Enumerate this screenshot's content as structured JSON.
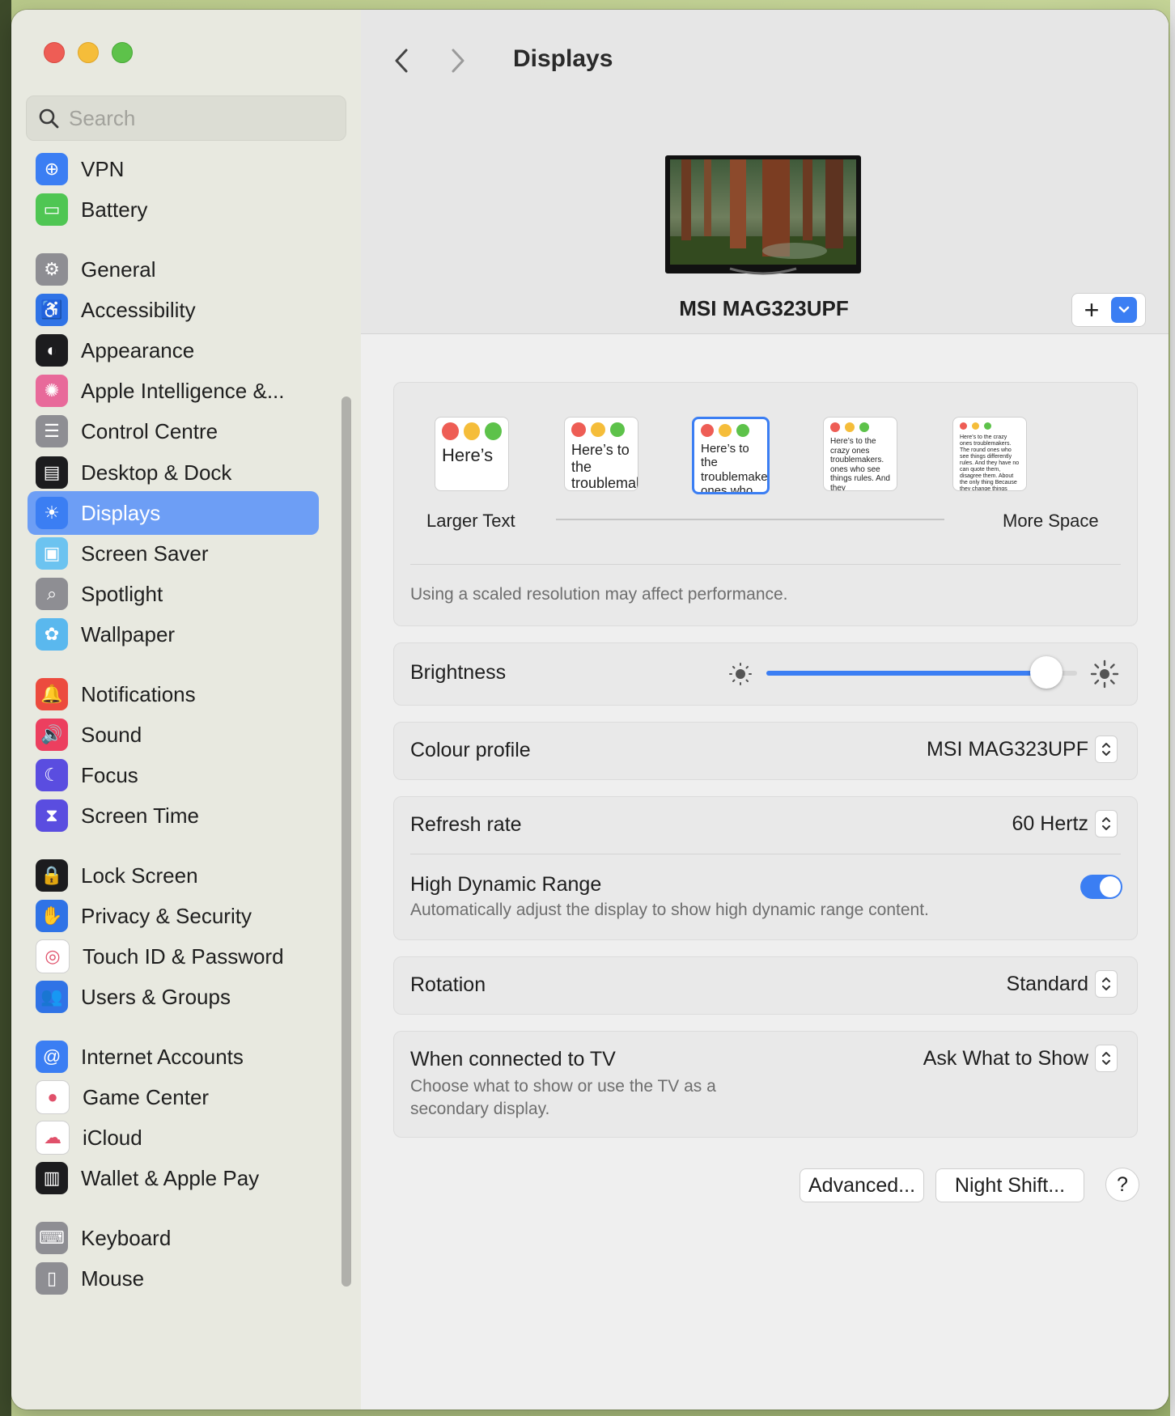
{
  "window": {
    "title": "Displays"
  },
  "search": {
    "placeholder": "Search"
  },
  "sidebar": {
    "items": [
      {
        "label": "VPN",
        "icon": "globe-icon",
        "color": "#3b7ef3",
        "selected": false
      },
      {
        "label": "Battery",
        "icon": "battery-icon",
        "color": "#4fc653",
        "selected": false
      },
      {
        "label": "General",
        "icon": "gear-icon",
        "color": "#8e8e93",
        "selected": false
      },
      {
        "label": "Accessibility",
        "icon": "accessibility-icon",
        "color": "#2f73e6",
        "selected": false
      },
      {
        "label": "Appearance",
        "icon": "appearance-icon",
        "color": "#1c1c1e",
        "selected": false
      },
      {
        "label": "Apple Intelligence &...",
        "icon": "apple-intelligence-icon",
        "color": "#e86a9a",
        "selected": false
      },
      {
        "label": "Control Centre",
        "icon": "control-centre-icon",
        "color": "#8e8e93",
        "selected": false
      },
      {
        "label": "Desktop & Dock",
        "icon": "dock-icon",
        "color": "#1c1c1e",
        "selected": false
      },
      {
        "label": "Displays",
        "icon": "sun-icon",
        "color": "#3b7ef3",
        "selected": true
      },
      {
        "label": "Screen Saver",
        "icon": "screen-saver-icon",
        "color": "#6cc3f0",
        "selected": false
      },
      {
        "label": "Spotlight",
        "icon": "magnifier-icon",
        "color": "#8e8e93",
        "selected": false
      },
      {
        "label": "Wallpaper",
        "icon": "flower-icon",
        "color": "#5ab8ee",
        "selected": false
      },
      {
        "label": "Notifications",
        "icon": "bell-icon",
        "color": "#ec4b3e",
        "selected": false
      },
      {
        "label": "Sound",
        "icon": "speaker-icon",
        "color": "#ec3f5f",
        "selected": false
      },
      {
        "label": "Focus",
        "icon": "moon-icon",
        "color": "#5a4de0",
        "selected": false
      },
      {
        "label": "Screen Time",
        "icon": "hourglass-icon",
        "color": "#5a4de0",
        "selected": false
      },
      {
        "label": "Lock Screen",
        "icon": "lock-icon",
        "color": "#1c1c1e",
        "selected": false
      },
      {
        "label": "Privacy & Security",
        "icon": "hand-icon",
        "color": "#2f73e6",
        "selected": false
      },
      {
        "label": "Touch ID & Password",
        "icon": "fingerprint-icon",
        "color": "#ffffff",
        "selected": false
      },
      {
        "label": "Users & Groups",
        "icon": "users-icon",
        "color": "#2f73e6",
        "selected": false
      },
      {
        "label": "Internet Accounts",
        "icon": "at-icon",
        "color": "#3b7ef3",
        "selected": false
      },
      {
        "label": "Game Center",
        "icon": "game-center-icon",
        "color": "#ffffff",
        "selected": false
      },
      {
        "label": "iCloud",
        "icon": "cloud-icon",
        "color": "#ffffff",
        "selected": false
      },
      {
        "label": "Wallet & Apple Pay",
        "icon": "wallet-icon",
        "color": "#1c1c1e",
        "selected": false
      },
      {
        "label": "Keyboard",
        "icon": "keyboard-icon",
        "color": "#8e8e93",
        "selected": false
      },
      {
        "label": "Mouse",
        "icon": "mouse-icon",
        "color": "#8e8e93",
        "selected": false
      }
    ]
  },
  "display": {
    "name": "MSI MAG323UPF",
    "add_label": "+"
  },
  "resolution": {
    "options": [
      {
        "preview": "Here’s",
        "selected": false
      },
      {
        "preview": "Here’s to the troublemakers",
        "selected": false
      },
      {
        "preview": "Here’s to the troublemakers ones who",
        "selected": true
      },
      {
        "preview": "Here’s to the crazy ones troublemakers. ones who see things rules. And they",
        "selected": false
      },
      {
        "preview": "Here’s to the crazy ones troublemakers. The round ones who see things differently rules. And they have no can quote them, disagree them. About the only thing Because they change things",
        "selected": false
      }
    ],
    "label_left": "Larger Text",
    "label_right": "More Space",
    "note": "Using a scaled resolution may affect performance."
  },
  "brightness": {
    "label": "Brightness",
    "level": 0.9
  },
  "colour_profile": {
    "label": "Colour profile",
    "value": "MSI MAG323UPF"
  },
  "refresh_rate": {
    "label": "Refresh rate",
    "value": "60 Hertz"
  },
  "hdr": {
    "label": "High Dynamic Range",
    "description": "Automatically adjust the display to show high dynamic range content.",
    "enabled": true
  },
  "rotation": {
    "label": "Rotation",
    "value": "Standard"
  },
  "tv": {
    "label": "When connected to TV",
    "description_line1": "Choose what to show or use the TV as a",
    "description_line2": "secondary display.",
    "value": "Ask What to Show"
  },
  "buttons": {
    "advanced": "Advanced...",
    "night_shift": "Night Shift...",
    "help": "?"
  },
  "colors": {
    "accent": "#3b7ef3",
    "sidebar_selected": "#6d9ef5"
  }
}
